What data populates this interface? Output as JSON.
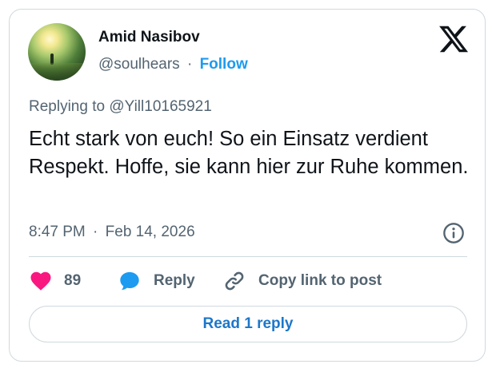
{
  "author": {
    "name": "Amid Nasibov",
    "handle": "@soulhears",
    "separator": "·",
    "follow_label": "Follow"
  },
  "reply_context": {
    "label": "Replying to @Yill10165921"
  },
  "post": {
    "text": "Echt stark von euch! So ein Einsatz verdient Respekt. Hoffe, sie kann hier zur Ruhe kommen.",
    "time": "8:47 PM",
    "date_separator": "·",
    "date": "Feb 14, 2026"
  },
  "actions": {
    "like_count": "89",
    "reply_label": "Reply",
    "copy_label": "Copy link to post"
  },
  "read_reply_label": "Read 1 reply",
  "colors": {
    "accent": "#1d9bf0",
    "like": "#f91880",
    "secondary_text": "#536471",
    "border": "#cfd9de"
  },
  "icons": {
    "brand": "x-logo-icon",
    "info": "info-icon",
    "like": "heart-icon",
    "reply": "speech-bubble-icon",
    "copy": "link-icon"
  }
}
